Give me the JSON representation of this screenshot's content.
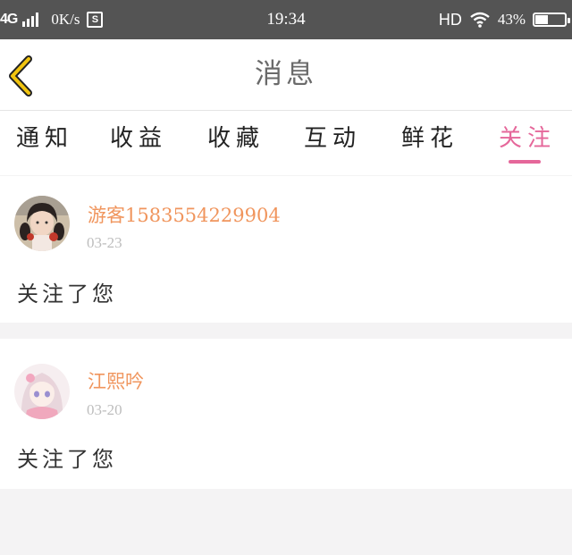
{
  "status_bar": {
    "network": "4G",
    "speed": "0K/s",
    "s_icon": "S",
    "time": "19:34",
    "hd": "HD",
    "battery_pct": "43%",
    "battery_level": 0.43
  },
  "header": {
    "title": "消息",
    "back_icon": "chevron-left-icon",
    "back_color": "#f1c40f"
  },
  "tabs": [
    {
      "label": "通知",
      "active": false
    },
    {
      "label": "收益",
      "active": false
    },
    {
      "label": "收藏",
      "active": false
    },
    {
      "label": "互动",
      "active": false
    },
    {
      "label": "鲜花",
      "active": false
    },
    {
      "label": "关注",
      "active": true
    }
  ],
  "colors": {
    "accent": "#e5679a",
    "username": "#f0955d",
    "date": "#bdbdbd"
  },
  "messages": [
    {
      "username": "游客1583554229904",
      "date": "03-23",
      "text": "关注了您"
    },
    {
      "username": "江熙吟",
      "date": "03-20",
      "text": "关注了您"
    }
  ]
}
